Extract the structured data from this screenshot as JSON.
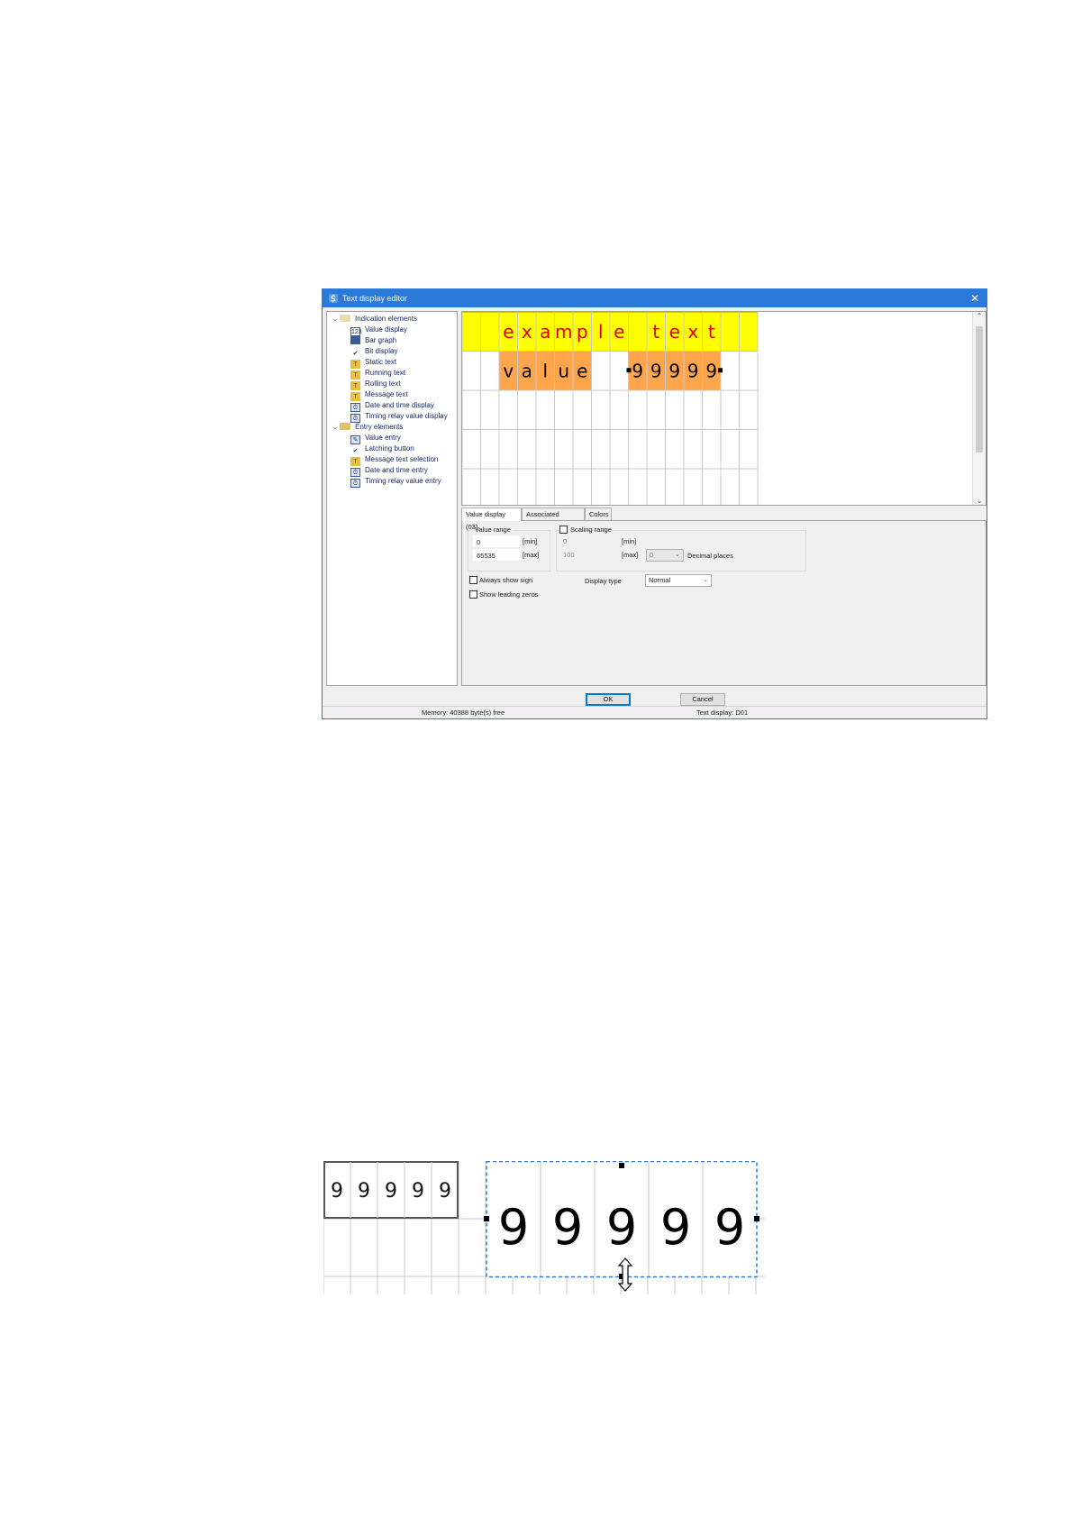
{
  "dialog": {
    "title": "Text display editor",
    "close_glyph": "✕"
  },
  "tree": {
    "groups": [
      {
        "label": "Indication elements",
        "expanded": true,
        "items": [
          {
            "label": "Value display",
            "icon": "value-display-icon"
          },
          {
            "label": "Bar graph",
            "icon": "bar-graph-icon"
          },
          {
            "label": "Bit display",
            "icon": "checkmark-icon"
          },
          {
            "label": "Static text",
            "icon": "static-text-icon"
          },
          {
            "label": "Running text",
            "icon": "running-text-icon"
          },
          {
            "label": "Rolling text",
            "icon": "rolling-text-icon"
          },
          {
            "label": "Message text",
            "icon": "message-text-icon"
          },
          {
            "label": "Date and time display",
            "icon": "date-time-display-icon"
          },
          {
            "label": "Timing relay value display",
            "icon": "timing-relay-display-icon"
          }
        ]
      },
      {
        "label": "Entry elements",
        "expanded": true,
        "items": [
          {
            "label": "Value entry",
            "icon": "value-entry-icon"
          },
          {
            "label": "Latching button",
            "icon": "latching-button-icon"
          },
          {
            "label": "Message text selection",
            "icon": "message-text-selection-icon"
          },
          {
            "label": "Date and time entry",
            "icon": "date-time-entry-icon"
          },
          {
            "label": "Timing relay value entry",
            "icon": "timing-relay-entry-icon"
          }
        ]
      }
    ]
  },
  "editor": {
    "row1_chars": [
      "",
      "",
      "e",
      "x",
      "a",
      "m",
      "p",
      "l",
      "e",
      "",
      "t",
      "e",
      "x",
      "t",
      "",
      ""
    ],
    "row2_label_chars": [
      "v",
      "a",
      "l",
      "u",
      "e"
    ],
    "row2_value_chars": [
      "9",
      "9",
      "9",
      "9",
      "9"
    ],
    "colors": {
      "text_bg": "#ffff00",
      "text_fg": "#e00000",
      "value_bg": "#ffa64d",
      "grid_line": "#c8c8c8"
    }
  },
  "tabs": [
    {
      "label": "Value display (03)",
      "active": true
    },
    {
      "label": "Associated variable",
      "active": false
    },
    {
      "label": "Colors",
      "active": false
    }
  ],
  "value_range": {
    "group_label": "Value range",
    "min_value": "0",
    "min_label": "[min]",
    "max_value": "65535",
    "max_label": "[max]"
  },
  "scaling_range": {
    "checkbox_label": "Scaling range",
    "checked": false,
    "min_value": "0",
    "min_label": "[min]",
    "max_value": "100",
    "max_label": "[max]",
    "decimal_value": "0",
    "decimal_label": "Decimal places"
  },
  "options": {
    "always_show_sign": "Always show sign",
    "show_leading_zeros": "Show leading zeros",
    "display_type_label": "Display type",
    "display_type_value": "Normal"
  },
  "buttons": {
    "ok": "OK",
    "cancel": "Cancel"
  },
  "status": {
    "memory": "Memory: 40388 byte(s) free",
    "text_display": "Text display: D01"
  },
  "zoom_figure": {
    "small_digits": [
      "9",
      "9",
      "9",
      "9",
      "9"
    ],
    "large_digits": [
      "9",
      "9",
      "9",
      "9",
      "9"
    ],
    "selection_color": "#2b7bd8"
  }
}
